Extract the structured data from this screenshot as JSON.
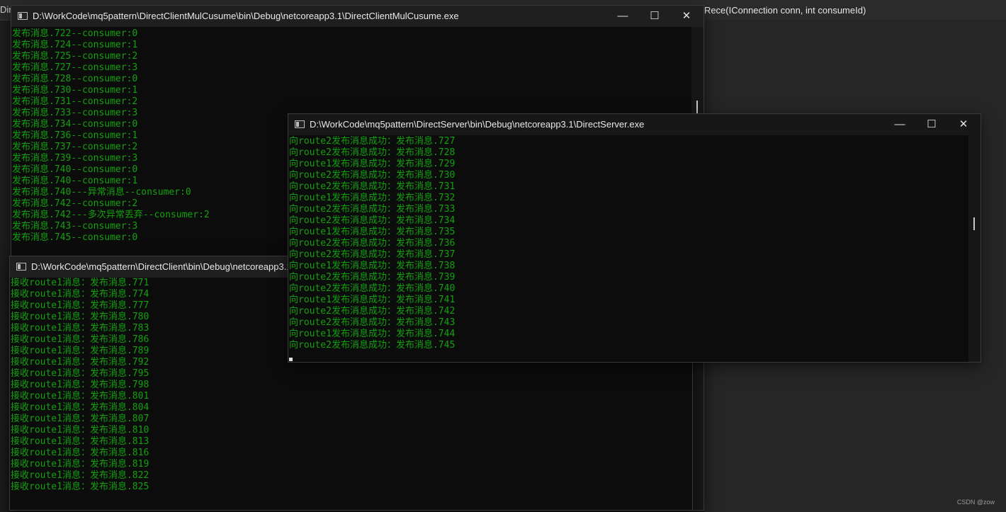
{
  "background": {
    "tab_left": "Dir",
    "editor_signature": "rtRece(IConnection conn, int consumeId)",
    "watermark": "CSDN @zow"
  },
  "colors": {
    "console_text": "#13a10e",
    "console_bg": "#0c0c0c",
    "titlebar_bg": "#1f1f1f"
  },
  "consumers_window": {
    "title": "D:\\WorkCode\\mq5pattern\\DirectClientMulCusume\\bin\\Debug\\netcoreapp3.1\\DirectClientMulCusume.exe",
    "controls": {
      "minimize": "—",
      "maximize": "☐",
      "close": "✕"
    },
    "lines": [
      "发布消息.722--consumer:0",
      "发布消息.724--consumer:1",
      "发布消息.725--consumer:2",
      "发布消息.727--consumer:3",
      "发布消息.728--consumer:0",
      "发布消息.730--consumer:1",
      "发布消息.731--consumer:2",
      "发布消息.733--consumer:3",
      "发布消息.734--consumer:0",
      "发布消息.736--consumer:1",
      "发布消息.737--consumer:2",
      "发布消息.739--consumer:3",
      "发布消息.740--consumer:0",
      "发布消息.740--consumer:1",
      "发布消息.740---异常消息--consumer:0",
      "发布消息.742--consumer:2",
      "发布消息.742---多次异常丢弃--consumer:2",
      "发布消息.743--consumer:3",
      "发布消息.745--consumer:0"
    ]
  },
  "client_window": {
    "title": "D:\\WorkCode\\mq5pattern\\DirectClient\\bin\\Debug\\netcoreapp3.1\\DirectClient.exe",
    "lines": [
      "接收route1消息：发布消息.771",
      "接收route1消息：发布消息.774",
      "接收route1消息：发布消息.777",
      "接收route1消息：发布消息.780",
      "接收route1消息：发布消息.783",
      "接收route1消息：发布消息.786",
      "接收route1消息：发布消息.789",
      "接收route1消息：发布消息.792",
      "接收route1消息：发布消息.795",
      "接收route1消息：发布消息.798",
      "接收route1消息：发布消息.801",
      "接收route1消息：发布消息.804",
      "接收route1消息：发布消息.807",
      "接收route1消息：发布消息.810",
      "接收route1消息：发布消息.813",
      "接收route1消息：发布消息.816",
      "接收route1消息：发布消息.819",
      "接收route1消息：发布消息.822",
      "接收route1消息：发布消息.825"
    ]
  },
  "server_window": {
    "title": "D:\\WorkCode\\mq5pattern\\DirectServer\\bin\\Debug\\netcoreapp3.1\\DirectServer.exe",
    "controls": {
      "minimize": "—",
      "maximize": "☐",
      "close": "✕"
    },
    "lines": [
      "向route2发布消息成功：发布消息.727",
      "向route2发布消息成功：发布消息.728",
      "向route1发布消息成功：发布消息.729",
      "向route2发布消息成功：发布消息.730",
      "向route2发布消息成功：发布消息.731",
      "向route1发布消息成功：发布消息.732",
      "向route2发布消息成功：发布消息.733",
      "向route2发布消息成功：发布消息.734",
      "向route1发布消息成功：发布消息.735",
      "向route2发布消息成功：发布消息.736",
      "向route2发布消息成功：发布消息.737",
      "向route1发布消息成功：发布消息.738",
      "向route2发布消息成功：发布消息.739",
      "向route2发布消息成功：发布消息.740",
      "向route1发布消息成功：发布消息.741",
      "向route2发布消息成功：发布消息.742",
      "向route2发布消息成功：发布消息.743",
      "向route1发布消息成功：发布消息.744",
      "向route2发布消息成功：发布消息.745"
    ]
  }
}
